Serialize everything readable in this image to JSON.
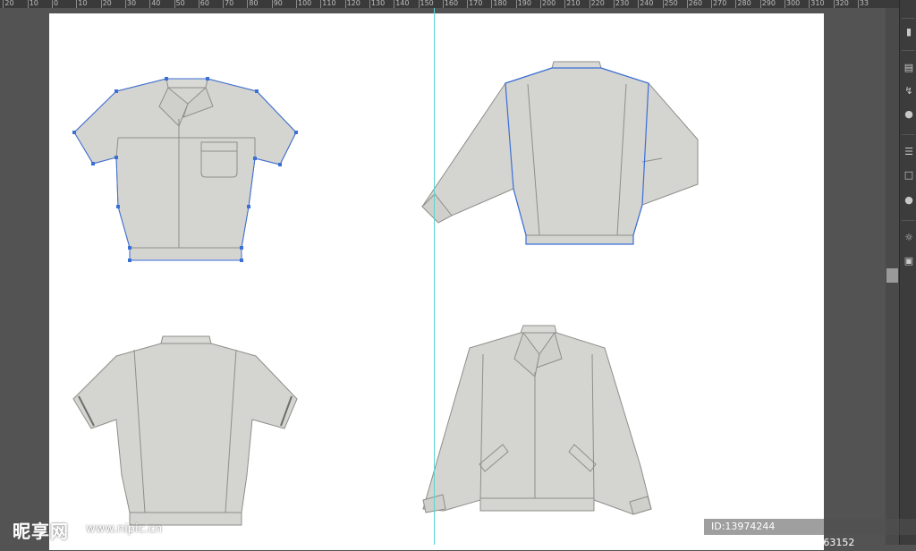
{
  "ruler": {
    "labels": [
      "20",
      "10",
      "0",
      "10",
      "20",
      "30",
      "40",
      "50",
      "60",
      "70",
      "80",
      "90",
      "100",
      "110",
      "120",
      "130",
      "140",
      "150",
      "160",
      "170",
      "180",
      "190",
      "200",
      "210",
      "220",
      "230",
      "240",
      "250",
      "260",
      "270",
      "280",
      "290",
      "300",
      "310",
      "320",
      "33"
    ]
  },
  "colors": {
    "workspace": "#535353",
    "artboard": "#ffffff",
    "garment_fill": "#d4d4d0",
    "garment_stroke": "#8e8e8a",
    "selection": "#3b6fd8",
    "guide": "#5fd3d3"
  },
  "artboard": {
    "objects": [
      {
        "name": "short-sleeve-shirt-front",
        "selected": true
      },
      {
        "name": "long-sleeve-jacket-back",
        "selected": true
      },
      {
        "name": "short-sleeve-shirt-back",
        "selected": false
      },
      {
        "name": "long-sleeve-jacket-front",
        "selected": false
      }
    ]
  },
  "right_panel": {
    "icons": [
      "brush-icon",
      "layers-icon",
      "link-icon",
      "pen-icon",
      "circle-icon",
      "list-icon",
      "artboard-icon",
      "color-icon",
      "appearance-icon",
      "transform-icon"
    ]
  },
  "watermark": {
    "logo": "昵享网",
    "url": "www.nipic.cn",
    "id_text": "ID:13974244 NO:20131018205409463152"
  }
}
